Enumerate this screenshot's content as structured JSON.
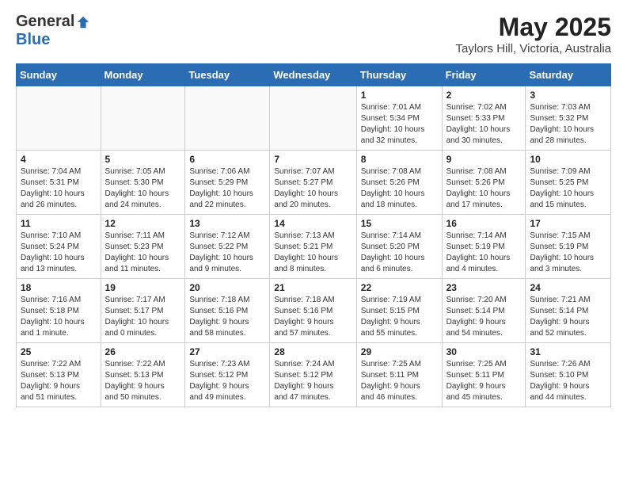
{
  "logo": {
    "general": "General",
    "blue": "Blue"
  },
  "header": {
    "month_year": "May 2025",
    "location": "Taylors Hill, Victoria, Australia"
  },
  "days_of_week": [
    "Sunday",
    "Monday",
    "Tuesday",
    "Wednesday",
    "Thursday",
    "Friday",
    "Saturday"
  ],
  "weeks": [
    [
      {
        "day": "",
        "info": ""
      },
      {
        "day": "",
        "info": ""
      },
      {
        "day": "",
        "info": ""
      },
      {
        "day": "",
        "info": ""
      },
      {
        "day": "1",
        "info": "Sunrise: 7:01 AM\nSunset: 5:34 PM\nDaylight: 10 hours\nand 32 minutes."
      },
      {
        "day": "2",
        "info": "Sunrise: 7:02 AM\nSunset: 5:33 PM\nDaylight: 10 hours\nand 30 minutes."
      },
      {
        "day": "3",
        "info": "Sunrise: 7:03 AM\nSunset: 5:32 PM\nDaylight: 10 hours\nand 28 minutes."
      }
    ],
    [
      {
        "day": "4",
        "info": "Sunrise: 7:04 AM\nSunset: 5:31 PM\nDaylight: 10 hours\nand 26 minutes."
      },
      {
        "day": "5",
        "info": "Sunrise: 7:05 AM\nSunset: 5:30 PM\nDaylight: 10 hours\nand 24 minutes."
      },
      {
        "day": "6",
        "info": "Sunrise: 7:06 AM\nSunset: 5:29 PM\nDaylight: 10 hours\nand 22 minutes."
      },
      {
        "day": "7",
        "info": "Sunrise: 7:07 AM\nSunset: 5:27 PM\nDaylight: 10 hours\nand 20 minutes."
      },
      {
        "day": "8",
        "info": "Sunrise: 7:08 AM\nSunset: 5:26 PM\nDaylight: 10 hours\nand 18 minutes."
      },
      {
        "day": "9",
        "info": "Sunrise: 7:08 AM\nSunset: 5:26 PM\nDaylight: 10 hours\nand 17 minutes."
      },
      {
        "day": "10",
        "info": "Sunrise: 7:09 AM\nSunset: 5:25 PM\nDaylight: 10 hours\nand 15 minutes."
      }
    ],
    [
      {
        "day": "11",
        "info": "Sunrise: 7:10 AM\nSunset: 5:24 PM\nDaylight: 10 hours\nand 13 minutes."
      },
      {
        "day": "12",
        "info": "Sunrise: 7:11 AM\nSunset: 5:23 PM\nDaylight: 10 hours\nand 11 minutes."
      },
      {
        "day": "13",
        "info": "Sunrise: 7:12 AM\nSunset: 5:22 PM\nDaylight: 10 hours\nand 9 minutes."
      },
      {
        "day": "14",
        "info": "Sunrise: 7:13 AM\nSunset: 5:21 PM\nDaylight: 10 hours\nand 8 minutes."
      },
      {
        "day": "15",
        "info": "Sunrise: 7:14 AM\nSunset: 5:20 PM\nDaylight: 10 hours\nand 6 minutes."
      },
      {
        "day": "16",
        "info": "Sunrise: 7:14 AM\nSunset: 5:19 PM\nDaylight: 10 hours\nand 4 minutes."
      },
      {
        "day": "17",
        "info": "Sunrise: 7:15 AM\nSunset: 5:19 PM\nDaylight: 10 hours\nand 3 minutes."
      }
    ],
    [
      {
        "day": "18",
        "info": "Sunrise: 7:16 AM\nSunset: 5:18 PM\nDaylight: 10 hours\nand 1 minute."
      },
      {
        "day": "19",
        "info": "Sunrise: 7:17 AM\nSunset: 5:17 PM\nDaylight: 10 hours\nand 0 minutes."
      },
      {
        "day": "20",
        "info": "Sunrise: 7:18 AM\nSunset: 5:16 PM\nDaylight: 9 hours\nand 58 minutes."
      },
      {
        "day": "21",
        "info": "Sunrise: 7:18 AM\nSunset: 5:16 PM\nDaylight: 9 hours\nand 57 minutes."
      },
      {
        "day": "22",
        "info": "Sunrise: 7:19 AM\nSunset: 5:15 PM\nDaylight: 9 hours\nand 55 minutes."
      },
      {
        "day": "23",
        "info": "Sunrise: 7:20 AM\nSunset: 5:14 PM\nDaylight: 9 hours\nand 54 minutes."
      },
      {
        "day": "24",
        "info": "Sunrise: 7:21 AM\nSunset: 5:14 PM\nDaylight: 9 hours\nand 52 minutes."
      }
    ],
    [
      {
        "day": "25",
        "info": "Sunrise: 7:22 AM\nSunset: 5:13 PM\nDaylight: 9 hours\nand 51 minutes."
      },
      {
        "day": "26",
        "info": "Sunrise: 7:22 AM\nSunset: 5:13 PM\nDaylight: 9 hours\nand 50 minutes."
      },
      {
        "day": "27",
        "info": "Sunrise: 7:23 AM\nSunset: 5:12 PM\nDaylight: 9 hours\nand 49 minutes."
      },
      {
        "day": "28",
        "info": "Sunrise: 7:24 AM\nSunset: 5:12 PM\nDaylight: 9 hours\nand 47 minutes."
      },
      {
        "day": "29",
        "info": "Sunrise: 7:25 AM\nSunset: 5:11 PM\nDaylight: 9 hours\nand 46 minutes."
      },
      {
        "day": "30",
        "info": "Sunrise: 7:25 AM\nSunset: 5:11 PM\nDaylight: 9 hours\nand 45 minutes."
      },
      {
        "day": "31",
        "info": "Sunrise: 7:26 AM\nSunset: 5:10 PM\nDaylight: 9 hours\nand 44 minutes."
      }
    ]
  ]
}
